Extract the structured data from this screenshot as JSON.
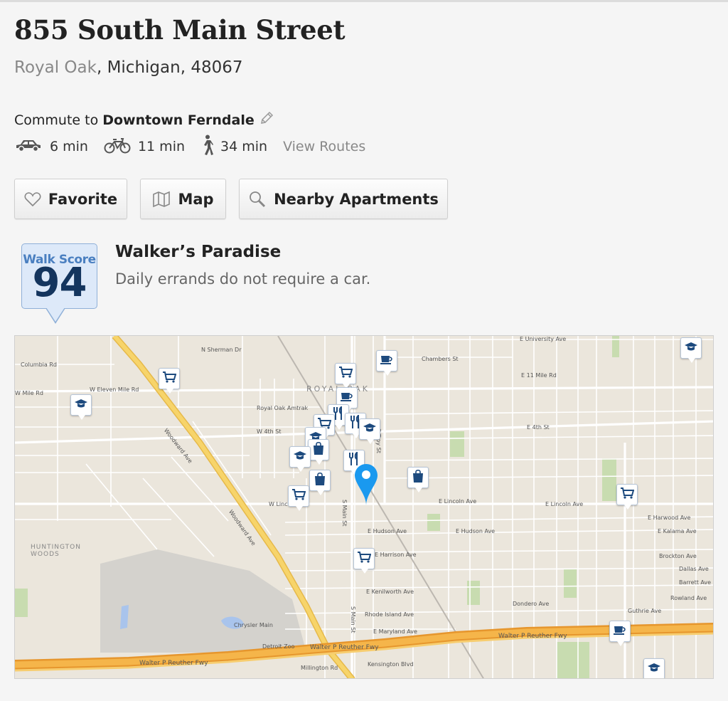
{
  "address": {
    "street": "855 South Main Street",
    "city": "Royal Oak",
    "state_zip": ", Michigan, 48067"
  },
  "commute": {
    "prefix": "Commute to",
    "destination": "Downtown Ferndale",
    "modes": [
      {
        "icon": "car-icon",
        "time": "6 min"
      },
      {
        "icon": "bike-icon",
        "time": "11 min"
      },
      {
        "icon": "walk-icon",
        "time": "34 min"
      }
    ],
    "view_routes": "View Routes"
  },
  "actions": {
    "favorite": "Favorite",
    "map": "Map",
    "nearby": "Nearby Apartments"
  },
  "walkscore": {
    "label": "Walk Score",
    "score": "94",
    "title": "Walker’s Paradise",
    "description": "Daily errands do not require a car."
  },
  "map": {
    "labels": {
      "w_eleven_mile": "W Eleven Mile Rd",
      "e_11_mile": "E 11 Mile Rd",
      "w_4th": "W 4th St",
      "e_4th": "E 4th St",
      "lincoln": "E Lincoln Ave",
      "w_lincoln": "W Lincoln Ave",
      "woodward": "Woodward Ave",
      "woodward2": "Woodward Ave",
      "royal_oak": "ROYAL OAK",
      "amtrak": "Royal Oak Amtrak",
      "huntington": "HUNTINGTON WOODS",
      "reuther1": "Walter P Reuther Fwy",
      "reuther2": "Walter P Reuther Fwy",
      "reuther3": "Walter P Reuther Fwy",
      "chrysler": "Chrysler Main",
      "detroit_zoo": "Detroit Zoo",
      "main_st": "S Main St",
      "main_st2": "S Main St",
      "troy": "S Troy St",
      "hudson": "E Hudson Ave",
      "harrison": "E Harrison Ave",
      "kenilworth": "E Kenilworth Ave",
      "rhode": "Rhode Island Ave",
      "maryland": "E Maryland Ave",
      "dondero": "Dondero Ave",
      "guthrie": "Guthrie Ave",
      "columbia": "Columbia Rd",
      "kensington": "Kensington Blvd",
      "millington": "Millington Rd",
      "w_mile": "W Mile Rd",
      "university": "E University Ave",
      "chambers": "Chambers St",
      "sherman": "N Sherman Dr",
      "e_harwood": "E Harwood Ave",
      "brockton": "Brockton Ave",
      "dallas": "Dallas Ave",
      "barrett": "Barrett Ave",
      "rowland": "Rowland Ave",
      "kalama": "E Kalama Ave"
    }
  }
}
